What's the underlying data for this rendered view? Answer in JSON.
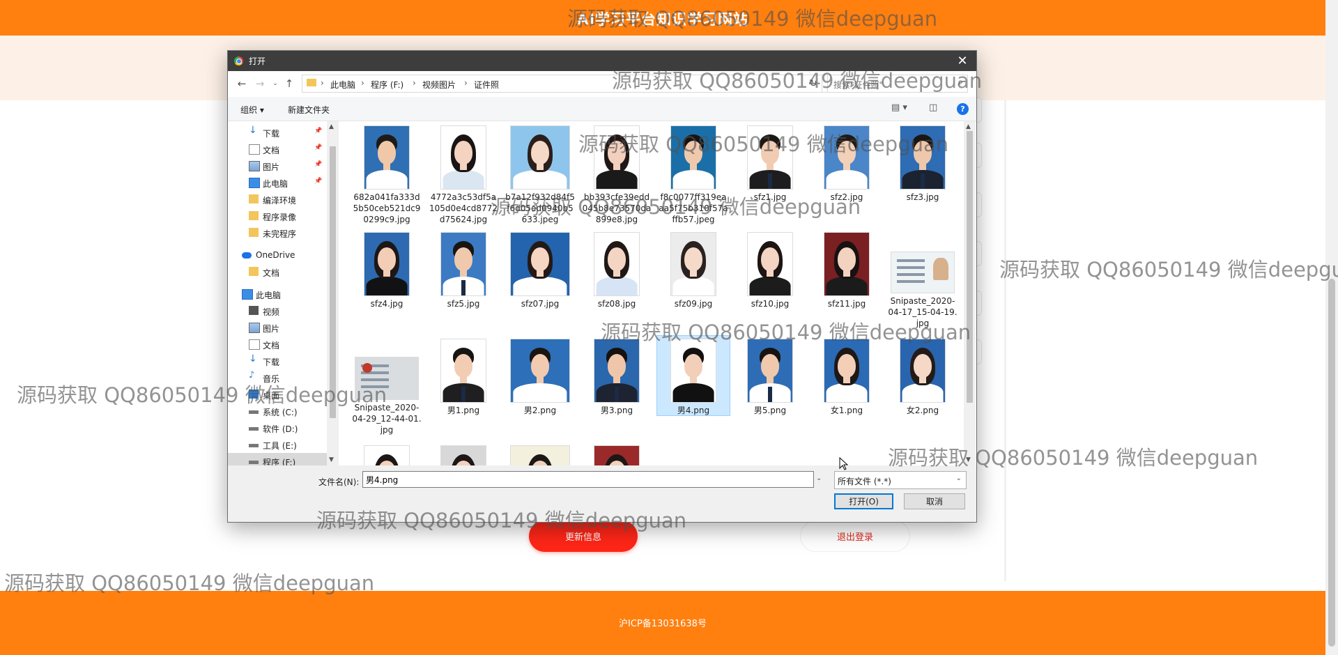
{
  "site": {
    "title": "AI学习平台知识学习网站",
    "update_button": "更新信息",
    "logout_button": "退出登录",
    "footer_text": "沪ICP备13031638号"
  },
  "dialog": {
    "title": "打开",
    "close_glyph": "✕",
    "breadcrumb": [
      "此电脑",
      "程序 (F:)",
      "视频图片",
      "证件照"
    ],
    "search_placeholder": "搜索\"证件照\"",
    "toolbar": {
      "organize": "组织 ▾",
      "new_folder": "新建文件夹"
    },
    "nav_items": [
      {
        "label": "下载",
        "icon": "download-arrow-icon",
        "pinned": true
      },
      {
        "label": "文档",
        "icon": "document-icon",
        "pinned": true
      },
      {
        "label": "图片",
        "icon": "picture-icon",
        "pinned": true
      },
      {
        "label": "此电脑",
        "icon": "computer-icon",
        "pinned": true
      },
      {
        "label": "编泽环境",
        "icon": "folder-icon",
        "pinned": false
      },
      {
        "label": "程序录像",
        "icon": "folder-icon",
        "pinned": false
      },
      {
        "label": "未完程序",
        "icon": "folder-icon",
        "pinned": false
      },
      {
        "label": "OneDrive",
        "icon": "cloud-icon",
        "pinned": false
      },
      {
        "label": "文档",
        "icon": "folder-icon",
        "pinned": false
      },
      {
        "label": "此电脑",
        "icon": "computer-icon",
        "pinned": false
      },
      {
        "label": "视频",
        "icon": "video-icon",
        "pinned": false
      },
      {
        "label": "图片",
        "icon": "picture-icon",
        "pinned": false
      },
      {
        "label": "文档",
        "icon": "document-icon",
        "pinned": false
      },
      {
        "label": "下载",
        "icon": "download-arrow-icon",
        "pinned": false
      },
      {
        "label": "音乐",
        "icon": "music-icon",
        "pinned": false
      },
      {
        "label": "桌面",
        "icon": "desktop-icon",
        "pinned": false
      },
      {
        "label": "系统 (C:)",
        "icon": "drive-icon",
        "pinned": false
      },
      {
        "label": "软件 (D:)",
        "icon": "drive-icon",
        "pinned": false
      },
      {
        "label": "工具 (E:)",
        "icon": "drive-icon",
        "pinned": false
      },
      {
        "label": "程序 (F:)",
        "icon": "drive-icon",
        "pinned": false,
        "selected": true
      }
    ],
    "files": [
      {
        "name": "682a041fa333d5b50ceb521dc90299c9.jpg",
        "bg": "#2f6fb3",
        "skin": "#f0c8a8",
        "hair": "#1e1a18",
        "cloth": "#ffffff",
        "kind": "m"
      },
      {
        "name": "4772a3c53df5a105d0e4cd8772d75624.jpg",
        "bg": "#ffffff",
        "skin": "#f4d3c0",
        "hair": "#1a1414",
        "cloth": "#dbe6f3",
        "kind": "f"
      },
      {
        "name": "b7a12f932d84f5f6d05ed0940b5633.jpeg",
        "bg": "#8ec5ec",
        "skin": "#f6d8c6",
        "hair": "#2a1f1b",
        "cloth": "#ffffff",
        "kind": "f"
      },
      {
        "name": "bb393cfe39edd045b8e73570da899e8.jpg",
        "bg": "#ffffff",
        "skin": "#f3cfbd",
        "hair": "#201816",
        "cloth": "#1a1a1a",
        "kind": "f"
      },
      {
        "name": "f8c0077ff319eaaa5f75b310f57affb57.jpeg",
        "bg": "#1b6fa8",
        "skin": "#f0c9ad",
        "hair": "#171312",
        "cloth": "#ffffff",
        "kind": "m"
      },
      {
        "name": "sfz1.jpg",
        "bg": "#ffffff",
        "skin": "#f2ccb2",
        "hair": "#1c1816",
        "cloth": "#1d1d1f",
        "kind": "mt"
      },
      {
        "name": "sfz2.jpg",
        "bg": "#4a86c8",
        "skin": "#f3d0b8",
        "hair": "#1f1a17",
        "cloth": "#ffffff",
        "kind": "m"
      },
      {
        "name": "sfz3.jpg",
        "bg": "#2e6cb4",
        "skin": "#efc7ab",
        "hair": "#1a1614",
        "cloth": "#1b2230",
        "kind": "mt"
      },
      {
        "name": "sfz4.jpg",
        "bg": "#2d6ab1",
        "skin": "#f3cdb6",
        "hair": "#1d1715",
        "cloth": "#121214",
        "kind": "f"
      },
      {
        "name": "sfz5.jpg",
        "bg": "#3c7bc4",
        "skin": "#f0c9ad",
        "hair": "#191513",
        "cloth": "#ffffff",
        "kind": "mt"
      },
      {
        "name": "sfz07.jpg",
        "bg": "#2463ad",
        "skin": "#f6d6c3",
        "hair": "#231a17",
        "cloth": "#ffffff",
        "kind": "f"
      },
      {
        "name": "sfz08.jpg",
        "bg": "#ffffff",
        "skin": "#f4d5c4",
        "hair": "#1f1816",
        "cloth": "#d6e4f5",
        "kind": "f"
      },
      {
        "name": "sfz09.jpg",
        "bg": "#ececec",
        "skin": "#f5d9c9",
        "hair": "#2a2220",
        "cloth": "#ffffff",
        "kind": "f"
      },
      {
        "name": "sfz10.jpg",
        "bg": "#ffffff",
        "skin": "#f4d4c2",
        "hair": "#1b1513",
        "cloth": "#1c1c1c",
        "kind": "f"
      },
      {
        "name": "sfz11.jpg",
        "bg": "#7a1f22",
        "skin": "#f3d2c0",
        "hair": "#171211",
        "cloth": "#1b1b1b",
        "kind": "f"
      },
      {
        "name": "Snipaste_2020-04-17_15-04-19.jpg",
        "bg": "#eef3f6",
        "skin": "#d7b08c",
        "hair": "#2a2a2a",
        "cloth": "#b2c3cf",
        "kind": "card"
      },
      {
        "name": "Snipaste_2020-04-29_12-44-01.jpg",
        "bg": "#d9dde0",
        "skin": "#c0392b",
        "hair": "#999999",
        "cloth": "#cfd4d8",
        "kind": "card2"
      },
      {
        "name": "男1.png",
        "bg": "#ffffff",
        "skin": "#f2cdb3",
        "hair": "#181412",
        "cloth": "#1f1f21",
        "kind": "mt"
      },
      {
        "name": "男2.png",
        "bg": "#2d6fb8",
        "skin": "#f1caaf",
        "hair": "#1a1513",
        "cloth": "#ffffff",
        "kind": "m"
      },
      {
        "name": "男3.png",
        "bg": "#2a67ad",
        "skin": "#efc6a9",
        "hair": "#161210",
        "cloth": "#1d2331",
        "kind": "mt"
      },
      {
        "name": "男4.png",
        "bg": "#ffffff",
        "skin": "#f2cfb8",
        "hair": "#141010",
        "cloth": "#111111",
        "kind": "m",
        "selected": true
      },
      {
        "name": "男5.png",
        "bg": "#2f6cb6",
        "skin": "#f0c8ac",
        "hair": "#181412",
        "cloth": "#ffffff",
        "kind": "mt"
      },
      {
        "name": "女1.png",
        "bg": "#2b6ab4",
        "skin": "#f3cfb8",
        "hair": "#1e1816",
        "cloth": "#ffffff",
        "kind": "f"
      },
      {
        "name": "女2.png",
        "bg": "#2965ae",
        "skin": "#f6d8c7",
        "hair": "#241b18",
        "cloth": "#ffffff",
        "kind": "f"
      },
      {
        "name": "",
        "bg": "#ffffff",
        "skin": "#f3d0bc",
        "hair": "#1d1715",
        "cloth": "#ffffff",
        "kind": "f"
      },
      {
        "name": "",
        "bg": "#d8d8d8",
        "skin": "#f3d0bc",
        "hair": "#1d1715",
        "cloth": "#ffffff",
        "kind": "f"
      },
      {
        "name": "",
        "bg": "#f3f0dd",
        "skin": "#f3d0bc",
        "hair": "#1d1715",
        "cloth": "#ffffff",
        "kind": "f"
      },
      {
        "name": "",
        "bg": "#9a2a2a",
        "skin": "#f3d0bc",
        "hair": "#1d1715",
        "cloth": "#ffffff",
        "kind": "f"
      }
    ],
    "filename_label": "文件名(N):",
    "filename_value": "男4.png",
    "filetype": "所有文件 (*.*)",
    "open_button": "打开(O)",
    "cancel_button": "取消"
  },
  "watermark_text": "源码获取 QQ86050149 微信deepguan"
}
